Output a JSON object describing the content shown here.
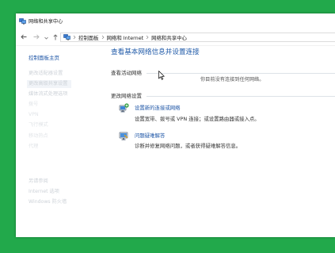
{
  "colors": {
    "background": "#22a94b",
    "window": "#ffffff",
    "heading": "#1f5aa8",
    "link": "#1d55a6",
    "text": "#333333",
    "muted": "#555555",
    "faded": "#cdd2d8",
    "separator": "#dde2e8"
  },
  "window": {
    "title": "网络和共享中心",
    "icon": "network-sharing-center-icon"
  },
  "nav": {
    "back_icon": "back-arrow-icon",
    "forward_icon": "forward-arrow-icon",
    "recent_icon": "chevron-down-icon",
    "up_icon": "up-arrow-icon",
    "location_icon": "network-icon",
    "separator_icon": "chevron-right-icon",
    "breadcrumb": [
      "控制面板",
      "网络和 Internet",
      "网络和共享中心"
    ]
  },
  "sidebar": {
    "home_link": "控制面板主页",
    "tasks": [
      "更改适配器设置",
      "更改高级共享设置",
      "媒体流式处理选项",
      "拨号",
      "VPN",
      "飞行模式",
      "移动热点",
      "代理"
    ],
    "see_also": [
      "另请参阅",
      "Internet 选项",
      "Windows 防火墙"
    ]
  },
  "main": {
    "heading": "查看基本网络信息并设置连接",
    "active_networks": {
      "label": "查看活动网络",
      "status": "你目前没有连接到任何网络。"
    },
    "change_settings": {
      "label": "更改网络设置",
      "tasks": [
        {
          "icon": "new-connection-icon",
          "title": "设置新的连接或网络",
          "description": "设置宽带、拨号或 VPN 连接；或设置路由器或接入点。"
        },
        {
          "icon": "troubleshoot-icon",
          "title": "问题疑难解答",
          "description": "诊断并修复网络问题，或者获得疑难解答信息。"
        }
      ]
    }
  },
  "cursor": {
    "icon": "mouse-cursor-icon"
  }
}
